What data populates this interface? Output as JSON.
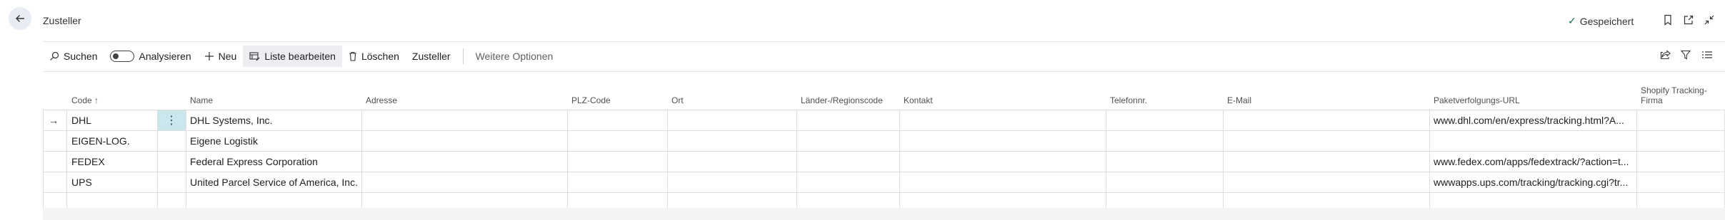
{
  "header": {
    "title": "Zusteller",
    "saved_label": "Gespeichert"
  },
  "actions": {
    "search": "Suchen",
    "analyze": "Analysieren",
    "new": "Neu",
    "edit_list": "Liste bearbeiten",
    "delete": "Löschen",
    "carrier": "Zusteller",
    "more_options": "Weitere Optionen"
  },
  "icons": {
    "back": "back-arrow-icon",
    "search": "search-icon",
    "new": "plus-icon",
    "edit_list": "edit-list-icon",
    "delete": "trash-icon",
    "saved": "check-icon",
    "bookmark": "bookmark-icon",
    "open_new": "open-in-new-window-icon",
    "collapse": "collapse-icon",
    "share": "share-icon",
    "filter": "filter-icon",
    "list": "list-icon"
  },
  "table": {
    "columns": {
      "code": "Code",
      "name": "Name",
      "address": "Adresse",
      "zip": "PLZ-Code",
      "city": "Ort",
      "country": "Länder-/Regionscode",
      "contact": "Kontakt",
      "phone": "Telefonnr.",
      "email": "E-Mail",
      "tracking_url": "Paketverfolgungs-URL",
      "shopify_line1": "Shopify Tracking-",
      "shopify_line2": "Firma"
    },
    "sort_indicator": "↑",
    "rows": [
      {
        "code": "DHL",
        "name": "DHL Systems, Inc.",
        "tracking_url": "www.dhl.com/en/express/tracking.html?A..."
      },
      {
        "code": "EIGEN-LOG.",
        "name": "Eigene Logistik",
        "tracking_url": ""
      },
      {
        "code": "FEDEX",
        "name": "Federal Express Corporation",
        "tracking_url": "www.fedex.com/apps/fedextrack/?action=t..."
      },
      {
        "code": "UPS",
        "name": "United Parcel Service of America, Inc.",
        "tracking_url": "wwwapps.ups.com/tracking/tracking.cgi?tr..."
      },
      {
        "code": "",
        "name": "",
        "tracking_url": ""
      }
    ]
  },
  "colors": {
    "selected_cell": "#cbe7ee",
    "active_action": "#eceef2",
    "saved_check": "#1f6f43"
  }
}
